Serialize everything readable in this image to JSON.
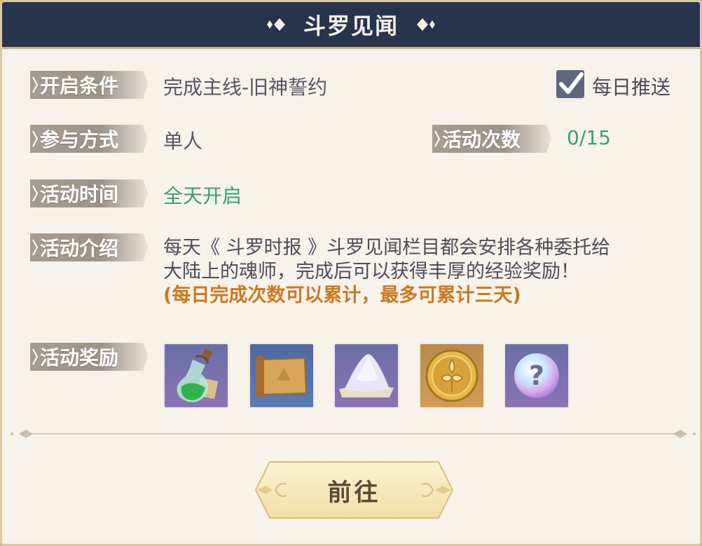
{
  "header": {
    "title": "斗罗见闻"
  },
  "rows": {
    "condition": {
      "label": "开启条件",
      "value": "完成主线-旧神誓约"
    },
    "mode": {
      "label": "参与方式",
      "value": "单人"
    },
    "count": {
      "label": "活动次数",
      "value": "0/15",
      "current": 0,
      "max": 15
    },
    "time": {
      "label": "活动时间",
      "value": "全天开启"
    },
    "intro": {
      "label": "活动介绍",
      "text_line1": "每天《 斗罗时报 》斗罗见闻栏目都会安排各种委托给",
      "text_line2": "大陆上的魂师，完成后可以获得丰厚的经验奖励！",
      "note": "(每日完成次数可以累计，最多可累计三天)"
    },
    "rewards": {
      "label": "活动奖励",
      "items": [
        {
          "icon": "green-potion-icon"
        },
        {
          "icon": "treasure-map-icon"
        },
        {
          "icon": "white-powder-icon"
        },
        {
          "icon": "gold-coin-icon"
        },
        {
          "icon": "mystery-orb-icon"
        }
      ]
    }
  },
  "push": {
    "label": "每日推送",
    "checked": true
  },
  "button": {
    "label": "前往"
  },
  "colors": {
    "header_bg": "#27344c",
    "panel_bg": "#f7f2ea",
    "green_text": "#37a36c",
    "note_text": "#c97a21"
  }
}
